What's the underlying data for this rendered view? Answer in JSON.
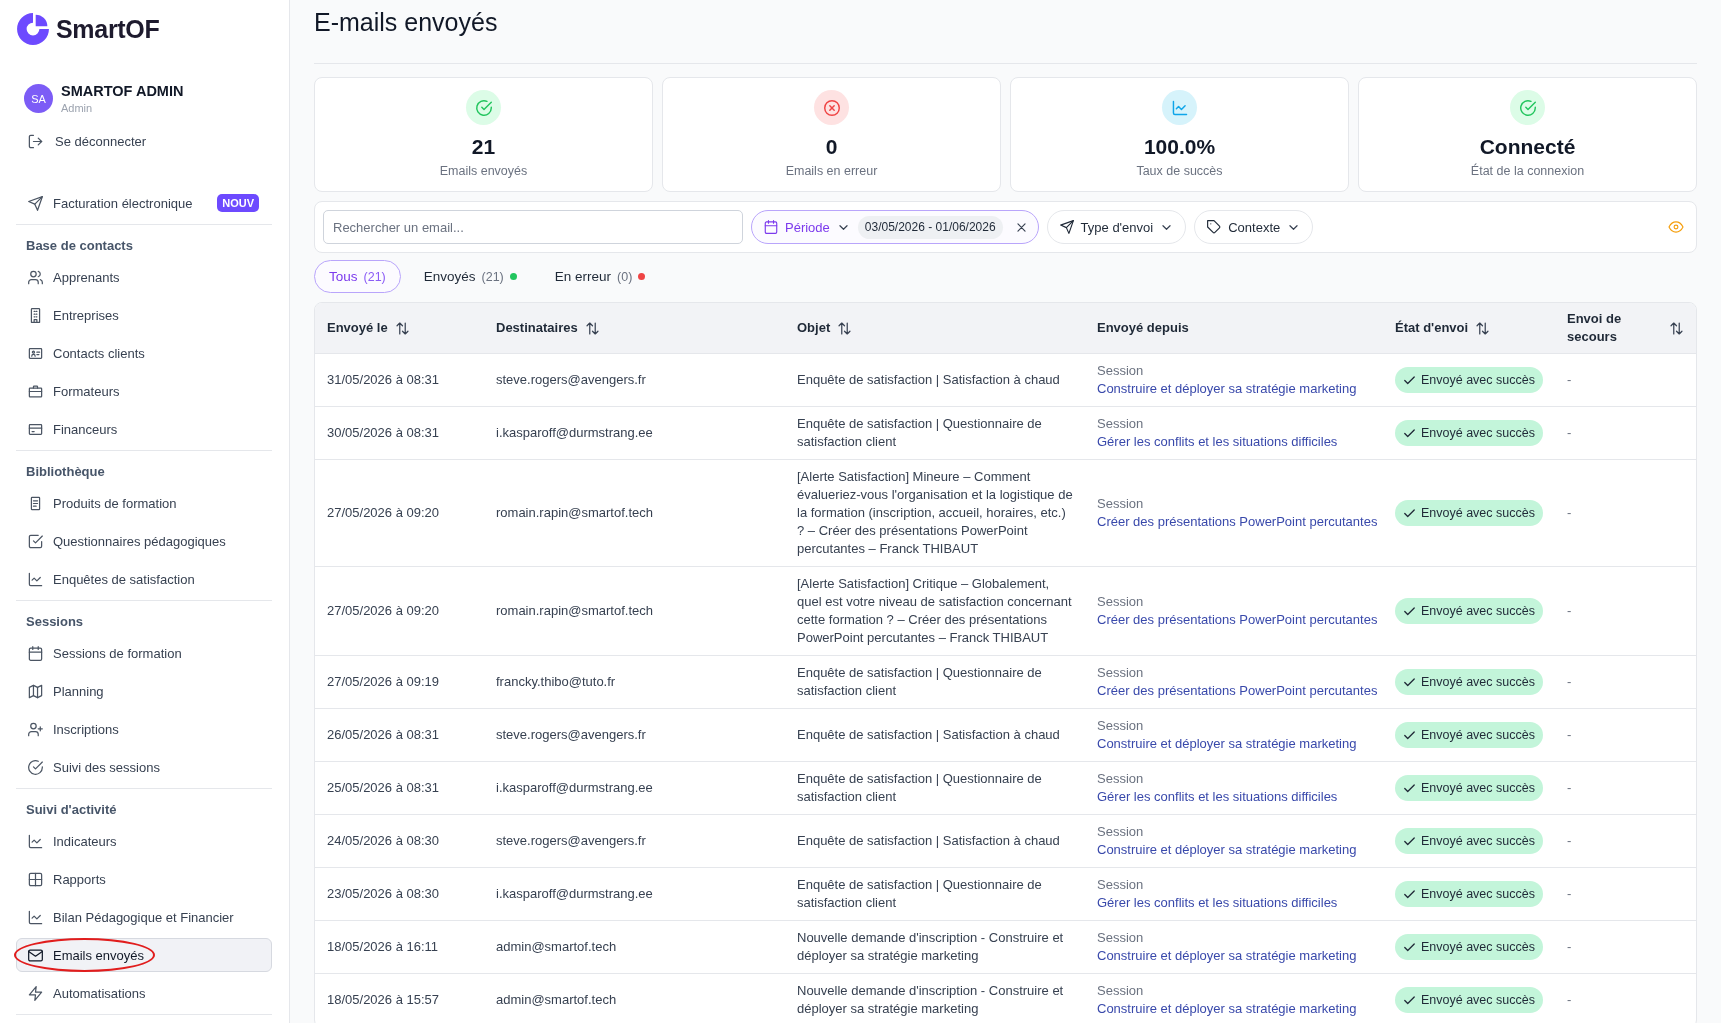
{
  "logo": {
    "text": "SmartOF"
  },
  "user": {
    "initials": "SA",
    "name": "SMARTOF ADMIN",
    "role": "Admin"
  },
  "logout": {
    "label": "Se déconnecter"
  },
  "sidebar": {
    "featured": {
      "label": "Facturation électronique",
      "badge": "NOUV",
      "selected": false
    },
    "sections": [
      {
        "title": "Base de contacts",
        "items": [
          {
            "label": "Apprenants",
            "selected": false,
            "circled": false
          },
          {
            "label": "Entreprises",
            "selected": false,
            "circled": false
          },
          {
            "label": "Contacts clients",
            "selected": false,
            "circled": false
          },
          {
            "label": "Formateurs",
            "selected": false,
            "circled": false
          },
          {
            "label": "Financeurs",
            "selected": false,
            "circled": false
          }
        ]
      },
      {
        "title": "Bibliothèque",
        "items": [
          {
            "label": "Produits de formation",
            "selected": false,
            "circled": false
          },
          {
            "label": "Questionnaires pédagogiques",
            "selected": false,
            "circled": false
          },
          {
            "label": "Enquêtes de satisfaction",
            "selected": false,
            "circled": false
          }
        ]
      },
      {
        "title": "Sessions",
        "items": [
          {
            "label": "Sessions de formation",
            "selected": false,
            "circled": false
          },
          {
            "label": "Planning",
            "selected": false,
            "circled": false
          },
          {
            "label": "Inscriptions",
            "selected": false,
            "circled": false
          },
          {
            "label": "Suivi des sessions",
            "selected": false,
            "circled": false
          }
        ]
      },
      {
        "title": "Suivi d'activité",
        "items": [
          {
            "label": "Indicateurs",
            "selected": false,
            "circled": false
          },
          {
            "label": "Rapports",
            "selected": false,
            "circled": false
          },
          {
            "label": "Bilan Pédagogique et Financier",
            "selected": false,
            "circled": false
          },
          {
            "label": "Emails envoyés",
            "selected": true,
            "circled": true
          },
          {
            "label": "Automatisations",
            "selected": false,
            "circled": false
          }
        ]
      }
    ]
  },
  "page": {
    "title": "E-mails envoyés"
  },
  "stats": [
    {
      "kind": "success",
      "value": "21",
      "label": "Emails envoyés"
    },
    {
      "kind": "error",
      "value": "0",
      "label": "Emails en erreur"
    },
    {
      "kind": "rate",
      "value": "100.0%",
      "label": "Taux de succès"
    },
    {
      "kind": "success",
      "value": "Connecté",
      "label": "État de la connexion"
    }
  ],
  "filters": {
    "search": {
      "placeholder": "Rechercher un email..."
    },
    "period": {
      "label": "Période",
      "range": "03/05/2026 - 01/06/2026"
    },
    "dropdowns": [
      {
        "label": "Type d'envoi"
      },
      {
        "label": "Contexte"
      }
    ]
  },
  "tabs": [
    {
      "label": "Tous",
      "count": "(21)",
      "selected": true
    },
    {
      "label": "Envoyés",
      "count": "(21)",
      "selected": false,
      "color": "#22c55e"
    },
    {
      "label": "En erreur",
      "count": "(0)",
      "selected": false,
      "color": "#ef4444"
    }
  ],
  "table": {
    "columns": [
      {
        "label": "Envoyé le",
        "sortable": true
      },
      {
        "label": "Destinataires",
        "sortable": true
      },
      {
        "label": "Objet",
        "sortable": true
      },
      {
        "label": "Envoyé depuis",
        "sortable": false
      },
      {
        "label": "État d'envoi",
        "sortable": true
      },
      {
        "label": "Envoi de secours",
        "sortable": true
      }
    ],
    "rows": [
      {
        "date": "31/05/2026 à 08:31",
        "recipient": "steve.rogers@avengers.fr",
        "subject": "Enquête de satisfaction | Satisfaction à chaud",
        "source": {
          "type": "Session",
          "link": "Construire et déployer sa stratégie marketing"
        },
        "status": {
          "kind": "success",
          "label": "Envoyé avec succès"
        },
        "fallback": "-"
      },
      {
        "date": "30/05/2026 à 08:31",
        "recipient": "i.kasparoff@durmstrang.ee",
        "subject": "Enquête de satisfaction | Questionnaire de satisfaction client",
        "source": {
          "type": "Session",
          "link": "Gérer les conflits et les situations difficiles"
        },
        "status": {
          "kind": "success",
          "label": "Envoyé avec succès"
        },
        "fallback": "-"
      },
      {
        "date": "27/05/2026 à 09:20",
        "recipient": "romain.rapin@smartof.tech",
        "subject": "[Alerte Satisfaction] Mineure – Comment évalueriez-vous l'organisation et la logistique de la formation (inscription, accueil, horaires, etc.) ? – Créer des présentations PowerPoint percutantes – Franck THIBAUT",
        "source": {
          "type": "Session",
          "link": "Créer des présentations PowerPoint percutantes"
        },
        "status": {
          "kind": "success",
          "label": "Envoyé avec succès"
        },
        "fallback": "-"
      },
      {
        "date": "27/05/2026 à 09:20",
        "recipient": "romain.rapin@smartof.tech",
        "subject": "[Alerte Satisfaction] Critique – Globalement, quel est votre niveau de satisfaction concernant cette formation ? – Créer des présentations PowerPoint percutantes – Franck THIBAUT",
        "source": {
          "type": "Session",
          "link": "Créer des présentations PowerPoint percutantes"
        },
        "status": {
          "kind": "success",
          "label": "Envoyé avec succès"
        },
        "fallback": "-"
      },
      {
        "date": "27/05/2026 à 09:19",
        "recipient": "francky.thibo@tuto.fr",
        "subject": "Enquête de satisfaction | Questionnaire de satisfaction client",
        "source": {
          "type": "Session",
          "link": "Créer des présentations PowerPoint percutantes"
        },
        "status": {
          "kind": "success",
          "label": "Envoyé avec succès"
        },
        "fallback": "-"
      },
      {
        "date": "26/05/2026 à 08:31",
        "recipient": "steve.rogers@avengers.fr",
        "subject": "Enquête de satisfaction | Satisfaction à chaud",
        "source": {
          "type": "Session",
          "link": "Construire et déployer sa stratégie marketing"
        },
        "status": {
          "kind": "success",
          "label": "Envoyé avec succès"
        },
        "fallback": "-"
      },
      {
        "date": "25/05/2026 à 08:31",
        "recipient": "i.kasparoff@durmstrang.ee",
        "subject": "Enquête de satisfaction | Questionnaire de satisfaction client",
        "source": {
          "type": "Session",
          "link": "Gérer les conflits et les situations difficiles"
        },
        "status": {
          "kind": "success",
          "label": "Envoyé avec succès"
        },
        "fallback": "-"
      },
      {
        "date": "24/05/2026 à 08:30",
        "recipient": "steve.rogers@avengers.fr",
        "subject": "Enquête de satisfaction | Satisfaction à chaud",
        "source": {
          "type": "Session",
          "link": "Construire et déployer sa stratégie marketing"
        },
        "status": {
          "kind": "success",
          "label": "Envoyé avec succès"
        },
        "fallback": "-"
      },
      {
        "date": "23/05/2026 à 08:30",
        "recipient": "i.kasparoff@durmstrang.ee",
        "subject": "Enquête de satisfaction | Questionnaire de satisfaction client",
        "source": {
          "type": "Session",
          "link": "Gérer les conflits et les situations difficiles"
        },
        "status": {
          "kind": "success",
          "label": "Envoyé avec succès"
        },
        "fallback": "-"
      },
      {
        "date": "18/05/2026 à 16:11",
        "recipient": "admin@smartof.tech",
        "subject": "Nouvelle demande d'inscription - Construire et déployer sa stratégie marketing",
        "source": {
          "type": "Session",
          "link": "Construire et déployer sa stratégie marketing"
        },
        "status": {
          "kind": "success",
          "label": "Envoyé avec succès"
        },
        "fallback": "-"
      },
      {
        "date": "18/05/2026 à 15:57",
        "recipient": "admin@smartof.tech",
        "subject": "Nouvelle demande d'inscription - Construire et déployer sa stratégie marketing",
        "source": {
          "type": "Session",
          "link": "Construire et déployer sa stratégie marketing"
        },
        "status": {
          "kind": "success",
          "label": "Envoyé avec succès"
        },
        "fallback": "-"
      }
    ]
  }
}
